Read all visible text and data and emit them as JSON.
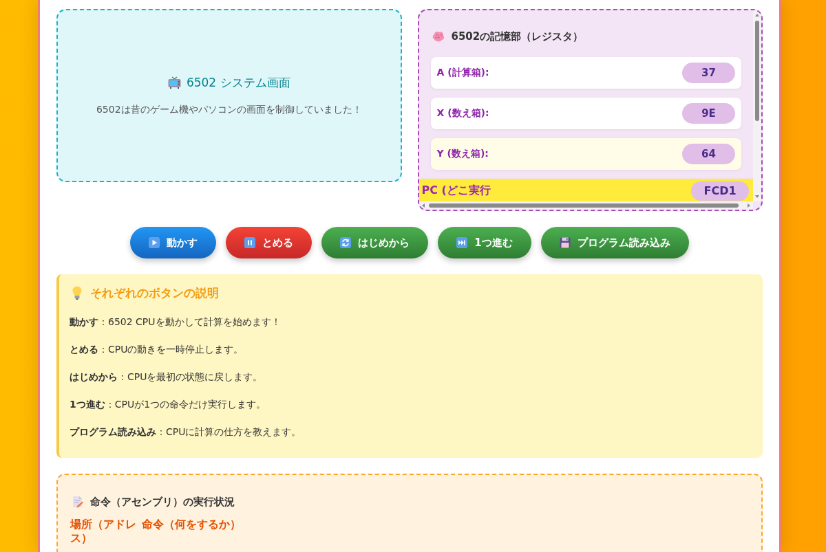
{
  "screen_panel": {
    "title": "6502 システム画面",
    "description": "6502は昔のゲーム機やパソコンの画面を制御していました！"
  },
  "registers_panel": {
    "title": "6502の記憶部（レジスタ）",
    "registers": [
      {
        "label": "A (計算箱):",
        "value": "37",
        "changed": false,
        "highlighted": false
      },
      {
        "label": "X (数え箱):",
        "value": "9E",
        "changed": false,
        "highlighted": false
      },
      {
        "label": "Y (数え箱):",
        "value": "64",
        "changed": true,
        "highlighted": false
      },
      {
        "label": "PC (どこ実行",
        "value": "FCD1",
        "changed": false,
        "highlighted": true
      }
    ]
  },
  "controls": [
    {
      "kind": "run",
      "label": "動かす"
    },
    {
      "kind": "pause",
      "label": "とめる"
    },
    {
      "kind": "reset",
      "label": "はじめから"
    },
    {
      "kind": "step",
      "label": "1つ進む"
    },
    {
      "kind": "load",
      "label": "プログラム読み込み"
    }
  ],
  "help": {
    "title": "それぞれのボタンの説明",
    "items": [
      "**動かす**：6502 CPUを動かして計算を始めます！",
      "**とめる**：CPUの動きを一時停止します。",
      "**はじめから**：CPUを最初の状態に戻します。",
      "**1つ進む**：CPUが1つの命令だけ実行します。",
      "**プログラム読み込み**：CPUに計算の仕方を教えます。"
    ]
  },
  "execution": {
    "title": "命令（アセンブリ）の実行状況",
    "columns": [
      "場所（アドレス）",
      "命令（何をするか）"
    ]
  }
}
